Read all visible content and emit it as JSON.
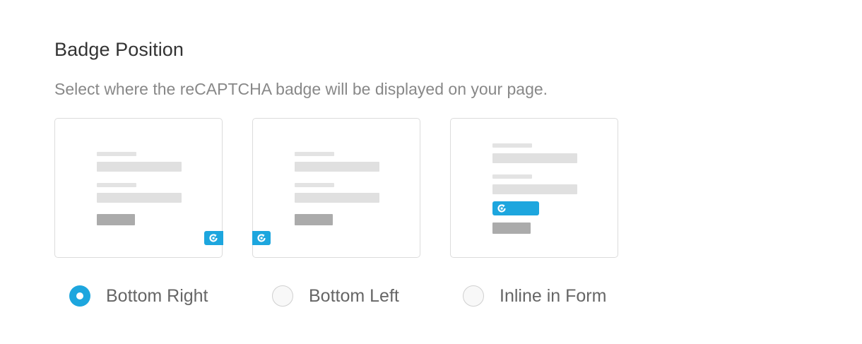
{
  "section": {
    "title": "Badge Position",
    "description": "Select where the reCAPTCHA badge will be displayed on your page."
  },
  "options": [
    {
      "label": "Bottom Right",
      "selected": true,
      "badge_icon": "recaptcha-icon"
    },
    {
      "label": "Bottom Left",
      "selected": false,
      "badge_icon": "recaptcha-icon"
    },
    {
      "label": "Inline in Form",
      "selected": false,
      "badge_icon": "recaptcha-icon"
    }
  ],
  "colors": {
    "accent": "#1da6de",
    "placeholder_bar": "#e0e0e0",
    "placeholder_button": "#ababab",
    "card_border": "#dcdcdc"
  }
}
